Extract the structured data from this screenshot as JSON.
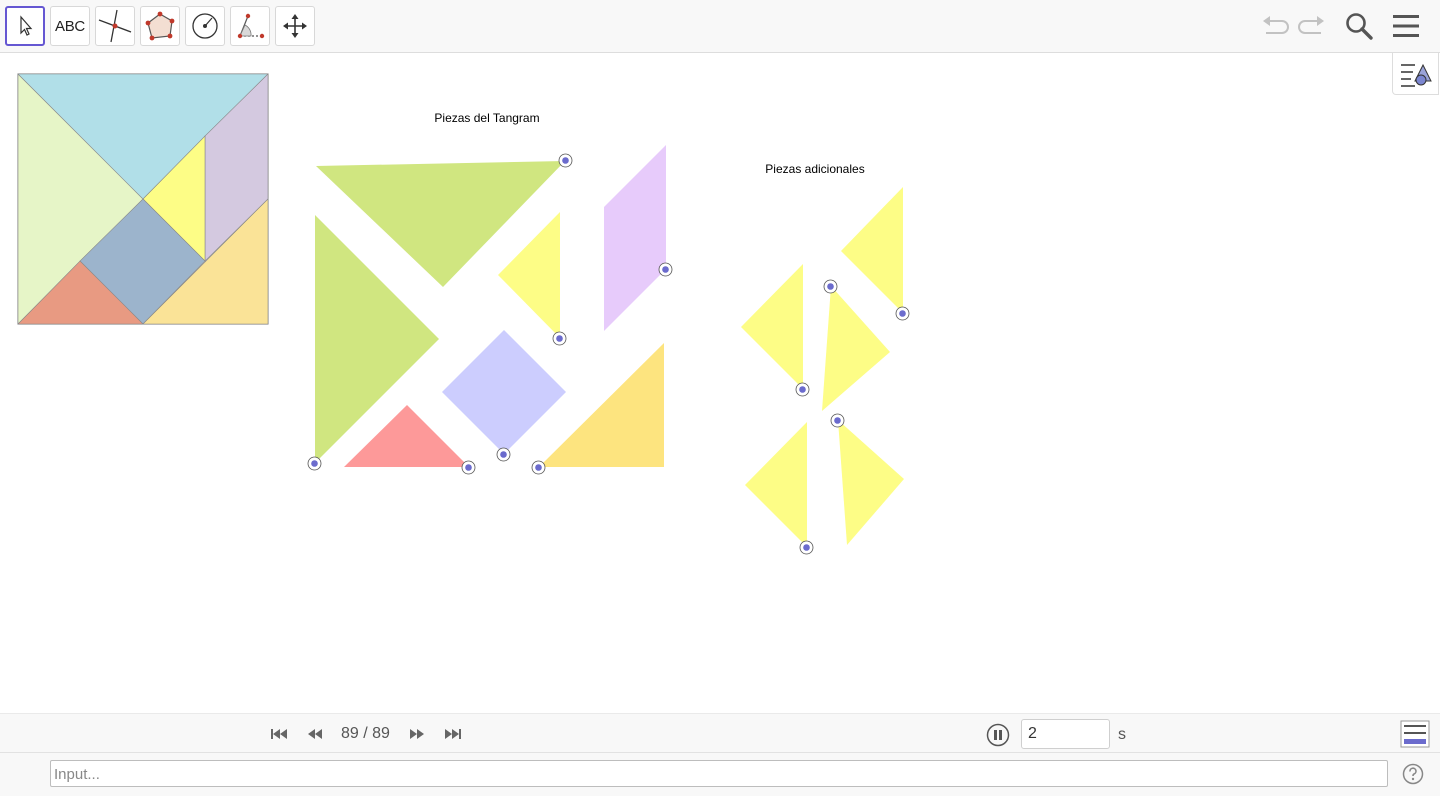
{
  "toolbar": {
    "tools": [
      {
        "name": "move-tool",
        "icon": "cursor-arrow-icon"
      },
      {
        "name": "text-tool",
        "icon": "text-icon",
        "label": "ABC"
      },
      {
        "name": "intersect-tool",
        "icon": "intersect-lines-icon"
      },
      {
        "name": "polygon-tool",
        "icon": "polygon-icon"
      },
      {
        "name": "circle-tool",
        "icon": "circle-icon"
      },
      {
        "name": "angle-tool",
        "icon": "angle-icon"
      },
      {
        "name": "move-view-tool",
        "icon": "move-cross-icon"
      }
    ],
    "selected_tool": "move-tool",
    "right_icons": [
      "undo-icon",
      "redo-icon",
      "search-icon",
      "menu-icon"
    ]
  },
  "graphics": {
    "labels": {
      "tangram_pieces": "Piezas del Tangram",
      "additional_pieces": "Piezas adicionales"
    },
    "colors": {
      "green": "#d0e680",
      "pale_green": "#e6f5c7",
      "light_blue": "#b1dfe8",
      "lavender": "#d4c9e0",
      "yellow": "#fdfd86",
      "steel_blue": "#9cb4cc",
      "salmon": "#e89a82",
      "sand": "#fae397",
      "purple": "#e7cbfb",
      "periwinkle": "#cccdfe",
      "red": "#fd9999",
      "orange_yellow": "#fde47f",
      "point_fill": "#6b6bcd"
    }
  },
  "stylebar": {
    "icon": "graphics-style-icon"
  },
  "animation": {
    "frame_text": "89 / 89",
    "speed": "2",
    "unit": "s",
    "buttons": [
      "first-frame-icon",
      "previous-frame-icon",
      "next-frame-icon",
      "last-frame-icon",
      "pause-icon"
    ],
    "algebra_icon": "algebra-view-icon"
  },
  "input_bar": {
    "placeholder": "Input...",
    "help_icon": "help-icon"
  }
}
